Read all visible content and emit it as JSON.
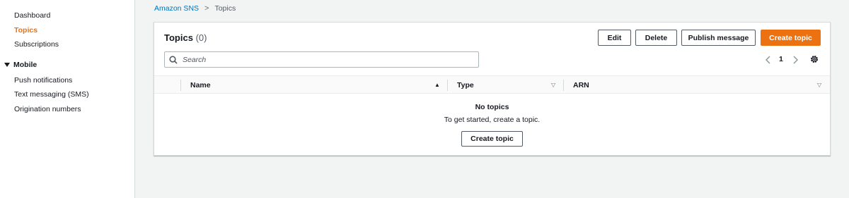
{
  "sidebar": {
    "items": [
      {
        "label": "Dashboard"
      },
      {
        "label": "Topics"
      },
      {
        "label": "Subscriptions"
      }
    ],
    "mobile_section": {
      "label": "Mobile",
      "items": [
        {
          "label": "Push notifications"
        },
        {
          "label": "Text messaging (SMS)"
        },
        {
          "label": "Origination numbers"
        }
      ]
    }
  },
  "breadcrumb": {
    "parent": "Amazon SNS",
    "separator": ">",
    "current": "Topics"
  },
  "panel": {
    "title": "Topics",
    "count": "(0)",
    "buttons": {
      "edit": "Edit",
      "delete": "Delete",
      "publish": "Publish message",
      "create": "Create topic"
    },
    "search": {
      "placeholder": "Search",
      "value": ""
    },
    "pagination": {
      "page": "1"
    },
    "table": {
      "columns": [
        "Name",
        "Type",
        "ARN"
      ]
    },
    "empty": {
      "title": "No topics",
      "description": "To get started, create a topic.",
      "button": "Create topic"
    }
  },
  "colors": {
    "accent": "#ec7211",
    "link": "#0073bb",
    "background": "#f2f3f3"
  }
}
